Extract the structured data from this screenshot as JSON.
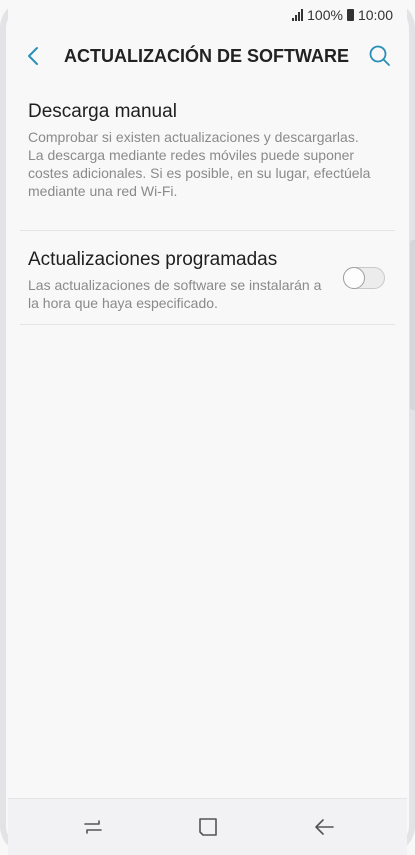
{
  "status_bar": {
    "battery_percent": "100%",
    "time": "10:00"
  },
  "app_bar": {
    "title": "ACTUALIZACIÓN DE SOFTWARE",
    "back_icon": "chevron-left-icon",
    "search_icon": "search-icon"
  },
  "settings": {
    "items": [
      {
        "title": "Descarga manual",
        "description": "Comprobar si existen actualizaciones y descargarlas.\nLa descarga mediante redes móviles puede suponer costes adicionales. Si es posible, en su lugar, efectúela mediante una red Wi-Fi."
      },
      {
        "title": "Actualizaciones programadas",
        "description": "Las actualizaciones de software se instalarán a la hora que haya especificado.",
        "toggle_on": false
      }
    ]
  },
  "nav_bar": {
    "recent_icon": "recent-apps-icon",
    "home_icon": "home-icon",
    "back_icon": "back-arrow-icon"
  },
  "colors": {
    "accent": "#2a8fb8",
    "background": "#f8f8f9",
    "title_text": "#222222",
    "secondary_text": "#8a8a8a"
  }
}
